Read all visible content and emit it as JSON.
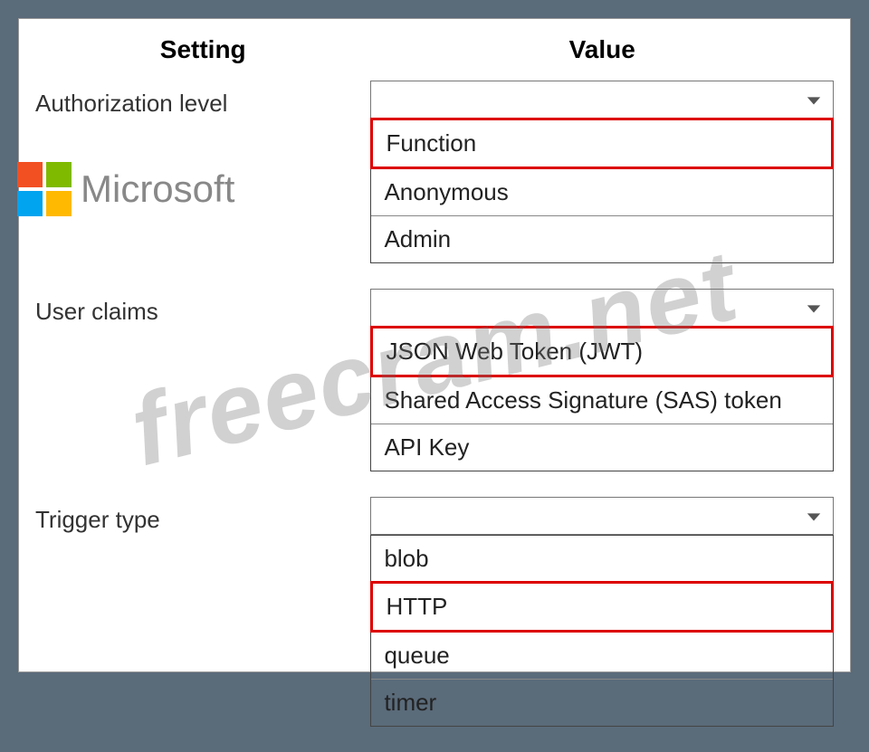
{
  "headers": {
    "setting": "Setting",
    "value": "Value"
  },
  "rows": [
    {
      "label": "Authorization level",
      "options": [
        "Function",
        "Anonymous",
        "Admin"
      ],
      "selected_index": 0
    },
    {
      "label": "User claims",
      "options": [
        "JSON Web Token (JWT)",
        "Shared Access Signature (SAS) token",
        "API Key"
      ],
      "selected_index": 0
    },
    {
      "label": "Trigger type",
      "options": [
        "blob",
        "HTTP",
        "queue",
        "timer"
      ],
      "selected_index": 1
    }
  ],
  "logo_text": "Microsoft",
  "watermark": "freecram.net",
  "colors": {
    "highlight": "#d00"
  }
}
